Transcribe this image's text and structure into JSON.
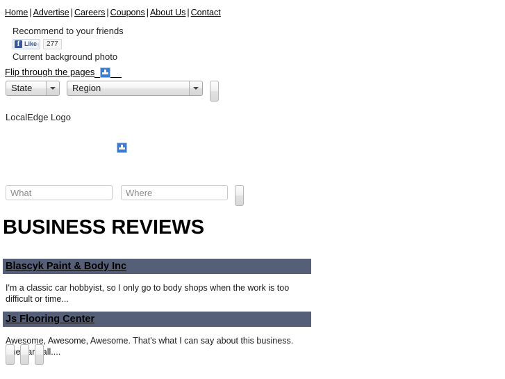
{
  "topnav": {
    "separator": "|",
    "links": [
      {
        "label": "Home"
      },
      {
        "label": "Advertise"
      },
      {
        "label": "Careers"
      },
      {
        "label": "Coupons"
      },
      {
        "label": "About Us"
      },
      {
        "label": "Contact"
      }
    ]
  },
  "social": {
    "recommend_label": "Recommend to your friends",
    "facebook_glyph": "f",
    "like_label": "Like",
    "like_count": "277"
  },
  "background": {
    "current_photo_label": "Current background photo",
    "flip_link": "Flip through the pages",
    "broken_image_icon": "broken-image-icon"
  },
  "filters": {
    "state": {
      "selected": "State",
      "options": [
        "State"
      ]
    },
    "region": {
      "selected": "Region",
      "options": [
        "Region"
      ]
    },
    "go_button_label": ""
  },
  "logo": {
    "alt_text": "LocalEdge Logo"
  },
  "hero": {
    "broken_image_icon": "broken-image-icon"
  },
  "search": {
    "what_placeholder": "What",
    "what_value": "",
    "where_placeholder": "Where",
    "where_value": "",
    "search_button_label": ""
  },
  "main": {
    "heading": "BUSINESS REVIEWS",
    "reviews": [
      {
        "business": "Blascyk Paint & Body Inc",
        "snippet": "I'm a classic car hobbyist, so I only go to body shops when the work is too difficult or time..."
      },
      {
        "business": "Js Flooring Center",
        "snippet": "Awesome, Awesome, Awesome. That's what I can say about this business. They are all...."
      }
    ]
  },
  "footer": {
    "buttons": [
      {
        "label": ""
      },
      {
        "label": ""
      },
      {
        "label": ""
      }
    ]
  },
  "colors": {
    "review_bar": "#556078",
    "facebook_blue": "#3b5998",
    "broken_image_blue": "#3a7bd5"
  }
}
